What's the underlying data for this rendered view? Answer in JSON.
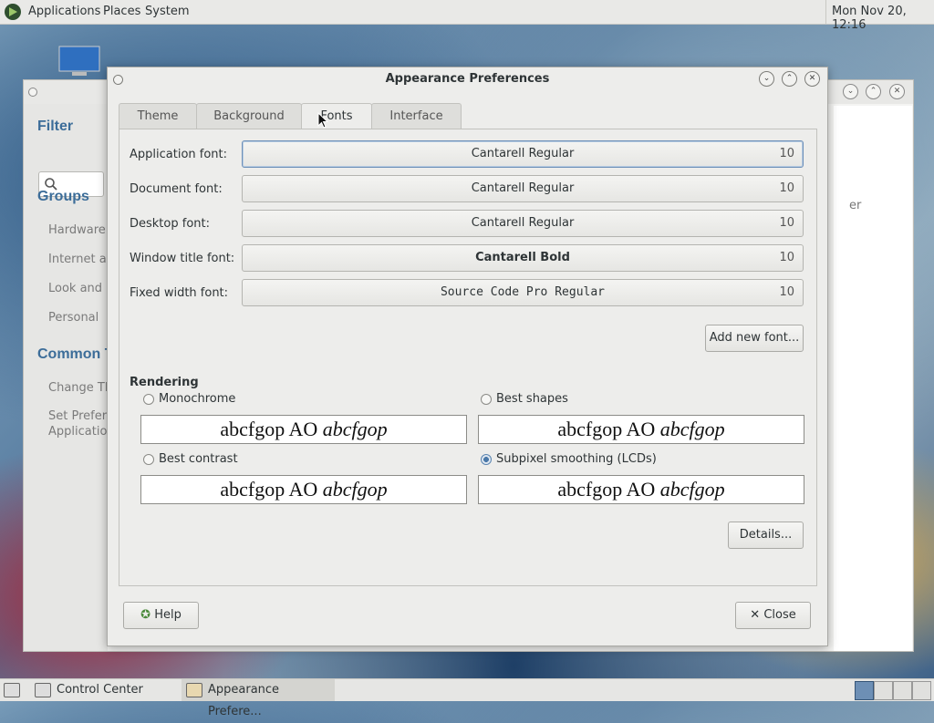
{
  "top_panel": {
    "menus": [
      "Applications",
      "Places",
      "System"
    ],
    "clock": "Mon Nov 20, 12:16"
  },
  "control_center": {
    "filter_heading": "Filter",
    "groups_heading": "Groups",
    "groups": [
      "Hardware",
      "Internet ar",
      "Look and F",
      "Personal"
    ],
    "common_heading": "Common T",
    "common_items": [
      "Change Th",
      "Set Prefer",
      "Applicatio"
    ],
    "right_fragment": "er"
  },
  "dialog": {
    "title": "Appearance Preferences",
    "tabs": [
      "Theme",
      "Background",
      "Fonts",
      "Interface"
    ],
    "active_tab": "Fonts",
    "fonts": [
      {
        "label": "Application font:",
        "name": "Cantarell Regular",
        "size": "10"
      },
      {
        "label": "Document font:",
        "name": "Cantarell Regular",
        "size": "10"
      },
      {
        "label": "Desktop font:",
        "name": "Cantarell Regular",
        "size": "10"
      },
      {
        "label": "Window title font:",
        "name": "Cantarell Bold",
        "size": "10"
      },
      {
        "label": "Fixed width font:",
        "name": "Source Code Pro Regular",
        "size": "10"
      }
    ],
    "add_font_label": "Add new font...",
    "rendering_label": "Rendering",
    "rendering_options": [
      {
        "label": "Monochrome",
        "checked": false,
        "sample": "abcfgop AO ",
        "sample_italic": "abcfgop"
      },
      {
        "label": "Best shapes",
        "checked": false,
        "sample": "abcfgop AO ",
        "sample_italic": "abcfgop"
      },
      {
        "label": "Best contrast",
        "checked": false,
        "sample": "abcfgop AO ",
        "sample_italic": "abcfgop"
      },
      {
        "label": "Subpixel smoothing (LCDs)",
        "checked": true,
        "sample": "abcfgop AO ",
        "sample_italic": "abcfgop"
      }
    ],
    "details_label": "Details...",
    "help_label": "Help",
    "close_label": "Close"
  },
  "taskbar": {
    "tasks": [
      "Control Center",
      "Appearance Prefere..."
    ]
  },
  "colors": {
    "accent": "#3c6d99",
    "selected_radio": "#4a78a8"
  }
}
